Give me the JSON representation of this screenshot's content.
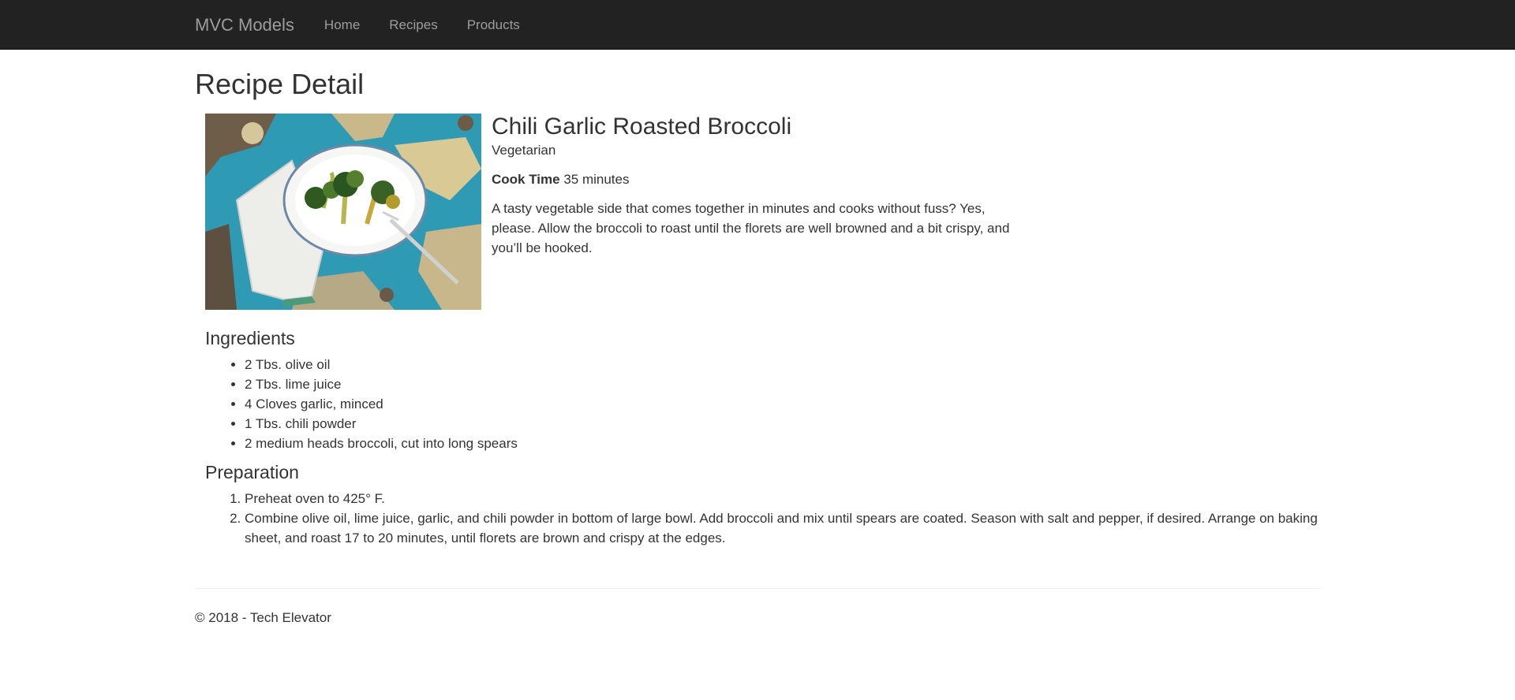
{
  "nav": {
    "brand": "MVC Models",
    "links": [
      "Home",
      "Recipes",
      "Products"
    ]
  },
  "page": {
    "title": "Recipe Detail"
  },
  "recipe": {
    "name": "Chili Garlic Roasted Broccoli",
    "type": "Vegetarian",
    "cook_time_label": "Cook Time",
    "cook_time_value": "35 minutes",
    "description": "A tasty vegetable side that comes together in minutes and cooks without fuss? Yes, please. Allow the broccoli to roast until the florets are well browned and a bit crispy, and you’ll be hooked.",
    "ingredients_title": "Ingredients",
    "ingredients": [
      "2 Tbs. olive oil",
      "2 Tbs. lime juice",
      "4 Cloves garlic, minced",
      "1 Tbs. chili powder",
      "2 medium heads broccoli, cut into long spears"
    ],
    "preparation_title": "Preparation",
    "preparation": [
      "Preheat oven to 425° F.",
      "Combine olive oil, lime juice, garlic, and chili powder in bottom of large bowl. Add broccoli and mix until spears are coated. Season with salt and pepper, if desired. Arrange on baking sheet, and roast 17 to 20 minutes, until florets are brown and crispy at the edges."
    ]
  },
  "footer": {
    "text": "© 2018 - Tech Elevator"
  },
  "colors": {
    "navbar": "#222222",
    "nav_text": "#9d9d9d",
    "body_text": "#333333"
  }
}
